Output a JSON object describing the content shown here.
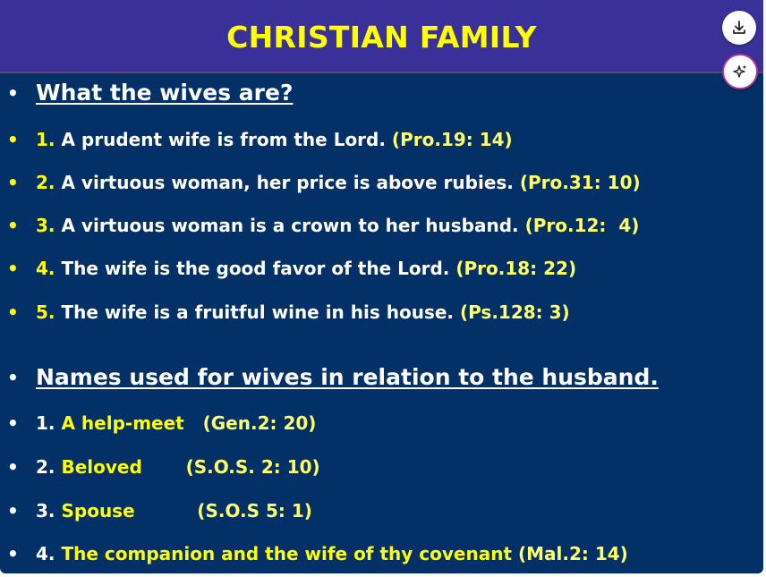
{
  "title": "CHRISTIAN FAMILY",
  "section1": {
    "heading": "What the wives are?",
    "items": [
      {
        "num": "1.",
        "text": " A prudent wife is from the Lord. ",
        "ref": "(Pro.19: 14)"
      },
      {
        "num": "2.",
        "text": " A virtuous woman, her price is above rubies. ",
        "ref": "(Pro.31: 10)"
      },
      {
        "num": "3.",
        "text": " A virtuous woman is a crown to her husband. ",
        "ref": "(Pro.12:  4)"
      },
      {
        "num": "4.",
        "text": " The wife is the good favor of the Lord. ",
        "ref": "(Pro.18: 22)"
      },
      {
        "num": "5.",
        "text": " The wife is a fruitful wine in his house. ",
        "ref": "(Ps.128: 3)"
      }
    ]
  },
  "section2": {
    "heading": "Names used for wives in relation to the husband.",
    "items": [
      {
        "num": "1.",
        "name": " A help-meet",
        "gap": "   ",
        "ref": "(Gen.2: 20)"
      },
      {
        "num": "2.",
        "name": " Beloved",
        "gap": "       ",
        "ref": "(S.O.S. 2: 10)"
      },
      {
        "num": "3.",
        "name": " Spouse",
        "gap": "          ",
        "ref": "(S.O.S 5: 1)"
      },
      {
        "num": "4.",
        "name": " The companion and the wife of thy covenant",
        "gap": " ",
        "ref": "(Mal.2: 14)"
      }
    ]
  },
  "buttons": {
    "download_icon": "download-icon",
    "ai_icon": "sparkle-icon"
  },
  "colors": {
    "slide_bg": "#033066",
    "title_bg": "#3a3099",
    "title_text": "#ffff00",
    "accent_text": "#ffff66"
  }
}
